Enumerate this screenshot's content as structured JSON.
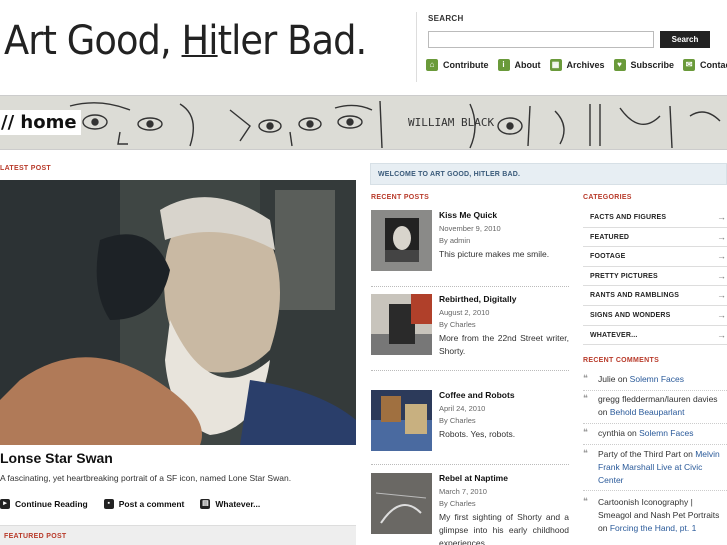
{
  "header": {
    "logo_pre": "Art Good, ",
    "logo_h": "Hi",
    "logo_post": "tler Bad.",
    "search_label": "SEARCH",
    "search_button": "Search",
    "nav": [
      {
        "label": "Contribute",
        "icon": "home-icon"
      },
      {
        "label": "About",
        "icon": "info-icon"
      },
      {
        "label": "Archives",
        "icon": "calendar-icon"
      },
      {
        "label": "Subscribe",
        "icon": "heart-icon"
      },
      {
        "label": "Contact",
        "icon": "mail-icon"
      }
    ]
  },
  "banner": {
    "page_heading": "// home",
    "drawing_words": "WILLIAM BLACK"
  },
  "latest": {
    "label": "LATEST POST",
    "title": "Lonse Star Swan",
    "excerpt": "A fascinating, yet heartbreaking portrait of a SF icon, named Lone Star Swan.",
    "actions": [
      {
        "label": "Continue Reading",
        "icon": "arrow-right-icon"
      },
      {
        "label": "Post a comment",
        "icon": "comment-icon"
      },
      {
        "label": "Whatever...",
        "icon": "folder-icon"
      }
    ],
    "featured_label": "FEATURED POST"
  },
  "welcome": "WELCOME TO ART GOOD, HITLER BAD.",
  "recent": {
    "label": "RECENT POSTS",
    "posts": [
      {
        "title": "Kiss Me Quick",
        "date": "November 9, 2010",
        "by": "By admin",
        "excerpt": "This picture makes me smile."
      },
      {
        "title": "Rebirthed, Digitally",
        "date": "August 2, 2010",
        "by": "By Charles",
        "excerpt": "More from the 22nd Street writer, Shorty."
      },
      {
        "title": "Coffee and Robots",
        "date": "April 24, 2010",
        "by": "By Charles",
        "excerpt": "Robots. Yes, robots."
      },
      {
        "title": "Rebel at Naptime",
        "date": "March 7, 2010",
        "by": "By Charles",
        "excerpt": "My first sighting of Shorty and a glimpse into his early childhood experiences..."
      }
    ]
  },
  "categories": {
    "label": "CATEGORIES",
    "items": [
      "FACTS AND FIGURES",
      "FEATURED",
      "FOOTAGE",
      "PRETTY PICTURES",
      "RANTS AND RAMBLINGS",
      "SIGNS AND WONDERS",
      "WHATEVER..."
    ]
  },
  "comments": {
    "label": "RECENT COMMENTS",
    "items": [
      {
        "author": "Julie",
        "on": " on ",
        "post": "Solemn Faces"
      },
      {
        "author": "gregg fledderman/lauren davies",
        "on": " on ",
        "post": "Behold Beauparlant"
      },
      {
        "author": "cynthia",
        "on": " on ",
        "post": "Solemn Faces"
      },
      {
        "author": "Party of the Third Part",
        "on": " on ",
        "post": "Melvin Frank Marshall Live at Civic Center"
      },
      {
        "author": "Cartoonish Iconography | Smeagol and Nash Pet Portraits",
        "on": " on ",
        "post": "Forcing the Hand, pt. 1"
      }
    ]
  },
  "colors": {
    "accent_red": "#b83a2a",
    "link_blue": "#2a5a9a",
    "nav_green": "#6a9a3a"
  }
}
